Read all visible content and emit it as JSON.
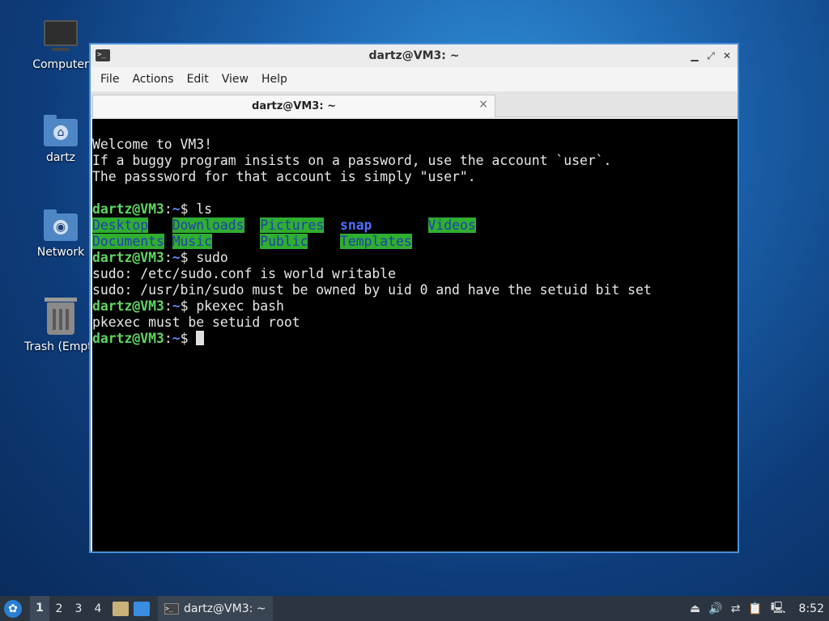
{
  "desktop": {
    "icons": [
      {
        "label": "Computer"
      },
      {
        "label": "dartz"
      },
      {
        "label": "Network"
      },
      {
        "label": "Trash (Empt"
      }
    ]
  },
  "window": {
    "title": "dartz@VM3: ~",
    "menu": [
      "File",
      "Actions",
      "Edit",
      "View",
      "Help"
    ],
    "tab_title": "dartz@VM3: ~",
    "tab_close": "×"
  },
  "terminal": {
    "motd": [
      "Welcome to VM3!",
      "If a buggy program insists on a password, use the account `user`.",
      "The passsword for that account is simply \"user\"."
    ],
    "prompt_user": "dartz@VM3",
    "prompt_sep": ":",
    "prompt_path": "~",
    "prompt_end": "$ ",
    "cmd1": "ls",
    "ls_row1": [
      "Desktop",
      "Downloads",
      "Pictures",
      "snap",
      "Videos"
    ],
    "ls_row2": [
      "Documents",
      "Music",
      "Public",
      "Templates"
    ],
    "cmd2": "sudo",
    "sudo_out1": "sudo: /etc/sudo.conf is world writable",
    "sudo_out2": "sudo: /usr/bin/sudo must be owned by uid 0 and have the setuid bit set",
    "cmd3": "pkexec bash",
    "pkexec_out": "pkexec must be setuid root"
  },
  "taskbar": {
    "workspaces": [
      "1",
      "2",
      "3",
      "4"
    ],
    "task_label": "dartz@VM3: ~",
    "clock": "8:52"
  }
}
